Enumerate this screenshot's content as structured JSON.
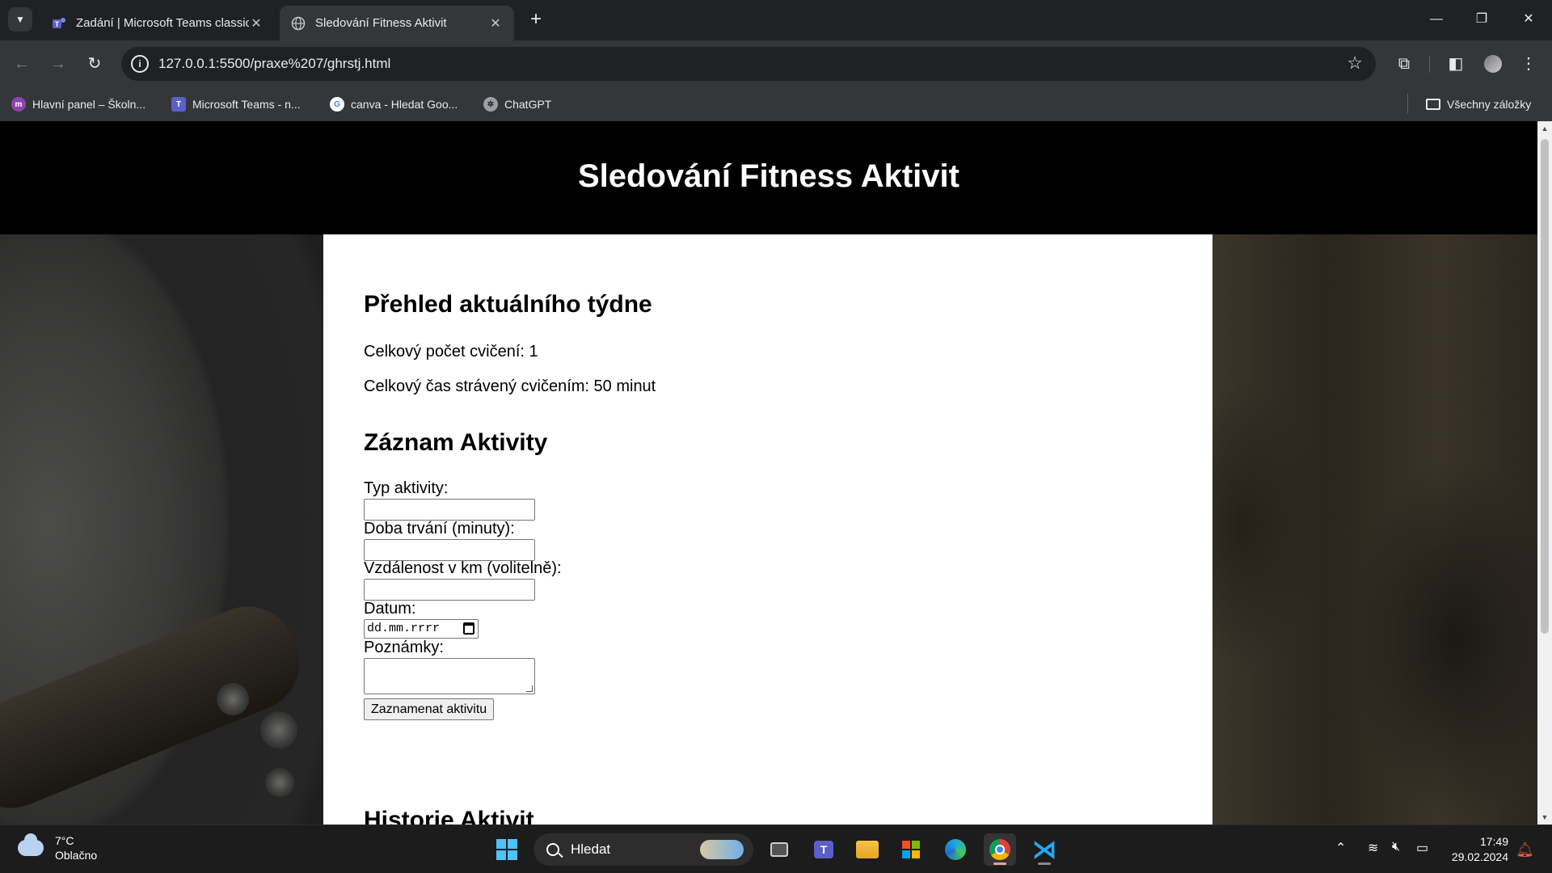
{
  "browser": {
    "tabs": [
      {
        "title": "Zadání | Microsoft Teams classic",
        "active": false
      },
      {
        "title": "Sledování Fitness Aktivit",
        "active": true
      }
    ],
    "url": "127.0.0.1:5500/praxe%207/ghrstj.html",
    "bookmarks": [
      {
        "label": "Hlavní panel – Školn..."
      },
      {
        "label": "Microsoft Teams - n..."
      },
      {
        "label": "canva - Hledat Goo..."
      },
      {
        "label": "ChatGPT"
      }
    ],
    "all_bookmarks": "Všechny záložky"
  },
  "page": {
    "header_title": "Sledování Fitness Aktivit",
    "overview": {
      "heading": "Přehled aktuálního týdne",
      "total_count": "Celkový počet cvičení: 1",
      "total_time": "Celkový čas strávený cvičením: 50 minut"
    },
    "form": {
      "heading": "Záznam Aktivity",
      "type_label": "Typ aktivity:",
      "duration_label": "Doba trvání (minuty):",
      "distance_label": "Vzdálenost v km (volitelně):",
      "date_label": "Datum:",
      "date_placeholder": "dd.mm.rrrr",
      "notes_label": "Poznámky:",
      "submit_label": "Zaznamenat aktivitu"
    },
    "history_heading": "Historie Aktivit"
  },
  "taskbar": {
    "weather_temp": "7°C",
    "weather_desc": "Oblačno",
    "search_label": "Hledat",
    "time": "17:49",
    "date": "29.02.2024"
  },
  "colors": {
    "teams": "#5b5fc7",
    "accent": "#4cc2ff",
    "vscode": "#23a9f2"
  }
}
